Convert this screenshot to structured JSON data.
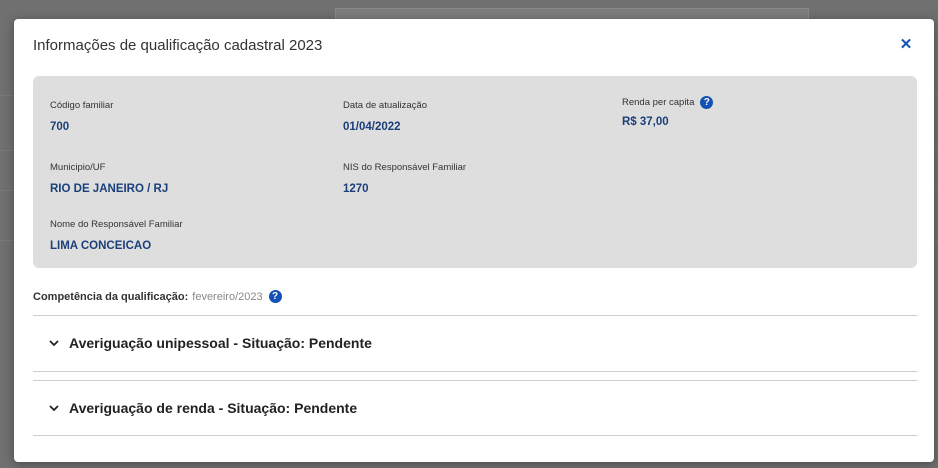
{
  "modal": {
    "title": "Informações de qualificação cadastral 2023",
    "close_icon": "close-icon"
  },
  "info": {
    "codigo_familiar": {
      "label": "Código familiar",
      "value": "700"
    },
    "data_atualizacao": {
      "label": "Data de atualização",
      "value": "01/04/2022"
    },
    "renda_per_capita": {
      "label": "Renda per capita",
      "value": "R$ 37,00",
      "icon": "question-circle-icon"
    },
    "municipio_uf": {
      "label": "Municipio/UF",
      "value": "RIO DE JANEIRO / RJ"
    },
    "nis_responsavel": {
      "label": "NIS do Responsável Familiar",
      "value": "1270"
    },
    "nome_responsavel": {
      "label": "Nome do Responsável Familiar",
      "value": "LIMA CONCEICAO"
    }
  },
  "competencia": {
    "label": "Competência da qualificação:",
    "value": "fevereiro/2023",
    "icon": "question-circle-icon"
  },
  "accordions": [
    {
      "title": "Averiguação unipessoal - Situação: Pendente",
      "icon": "chevron-down-icon"
    },
    {
      "title": "Averiguação de renda - Situação: Pendente",
      "icon": "chevron-down-icon"
    }
  ],
  "colors": {
    "accent": "#1351b4",
    "value_text": "#1b3f7a",
    "panel_bg": "#dedede"
  }
}
